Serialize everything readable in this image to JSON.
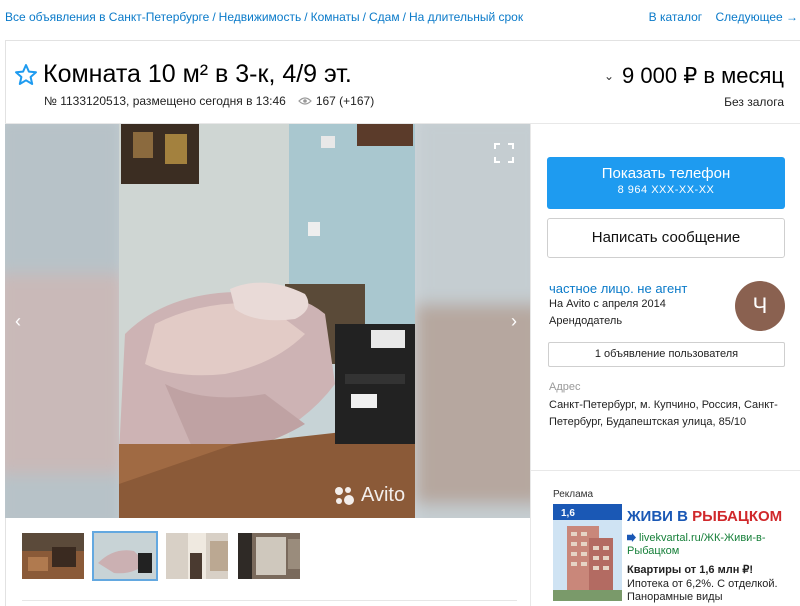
{
  "breadcrumbs": {
    "items": [
      "Все объявления в Санкт-Петербурге",
      "Недвижимость",
      "Комнаты",
      "Сдам",
      "На длительный срок"
    ],
    "separator": "/"
  },
  "topnav": {
    "catalog": "В каталог",
    "next": "Следующее →"
  },
  "listing": {
    "title": "Комната 10 м² в 3-к, 4/9 эт.",
    "meta": "№ 1133120513, размещено сегодня в 13:46",
    "views": "167 (+167)",
    "price": "9 000 ₽ в месяц",
    "deposit": "Без залога"
  },
  "gallery": {
    "watermark": "Avito",
    "thumbnail_count": 4,
    "active_thumbnail": 2
  },
  "contact": {
    "show_phone": "Показать телефон",
    "phone_masked": "8 964 XXX-XX-XX",
    "write_message": "Написать сообщение"
  },
  "seller": {
    "name": "частное лицо. не агент",
    "since": "На Avito с апреля 2014",
    "role": "Арендодатель",
    "avatar_letter": "Ч",
    "ads_button": "1 объявление пользователя"
  },
  "address": {
    "label": "Адрес",
    "value": "Санкт-Петербург, м. Купчино, Россия, Санкт-Петербург, Будапештская улица, 85/10"
  },
  "ad": {
    "label": "Реклама",
    "headline_part1": "ЖИВИ В",
    "headline_part2": "РЫБАЦКОМ",
    "link": "livekvartal.ru/ЖК-Живи-в-Рыбацком",
    "line1": "Квартиры от 1,6 млн ₽!",
    "line2": "Ипотека от 6,2%. С отделкой. Панорамные виды",
    "badge": "1,6"
  },
  "colors": {
    "link": "#0a7ac9",
    "primary_button": "#1e9bf0",
    "avatar": "#8a6150",
    "ad_link": "#17803a"
  },
  "icons": {
    "favorite": "star-outline-icon",
    "views": "eye-icon",
    "fullscreen": "expand-icon",
    "prev": "chevron-left-icon",
    "next": "chevron-right-icon"
  }
}
